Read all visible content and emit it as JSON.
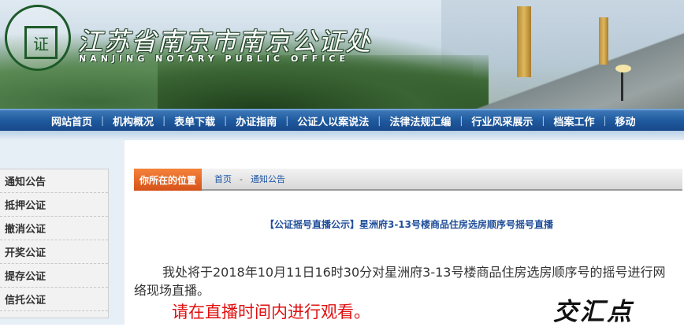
{
  "header": {
    "title": "江苏省南京市南京公证处",
    "subtitle": "NANJING NOTARY PUBLIC OFFICE",
    "logo_ring_text": "NANJING NOTARY PUBLIC OFFICE",
    "logo_top_text": "南京公证处"
  },
  "nav": {
    "items": [
      "网站首页",
      "机构概况",
      "表单下载",
      "办证指南",
      "公证人以案说法",
      "法律法规汇编",
      "行业风采展示",
      "档案工作",
      "移动"
    ]
  },
  "sidebar": {
    "items": [
      "通知公告",
      "抵押公证",
      "撤消公证",
      "开奖公证",
      "提存公证",
      "信托公证"
    ]
  },
  "breadcrumb": {
    "label": "你所在的位置",
    "home": "首页",
    "separator": "-",
    "current": "通知公告"
  },
  "article": {
    "title": "【公证摇号直播公示】星洲府3-13号楼商品住房选房顺序号摇号直播",
    "body": "我处将于2018年10月11日16时30分对星洲府3-13号楼商品住房选房顺序号的摇号进行网络现场直播。",
    "highlight": "请在直播时间内进行观看。"
  },
  "watermark": "交汇点",
  "colors": {
    "nav_blue": "#1f5a9e",
    "breadcrumb_orange": "#e8652a",
    "title_blue": "#1f4e99",
    "highlight_red": "#e01010"
  }
}
